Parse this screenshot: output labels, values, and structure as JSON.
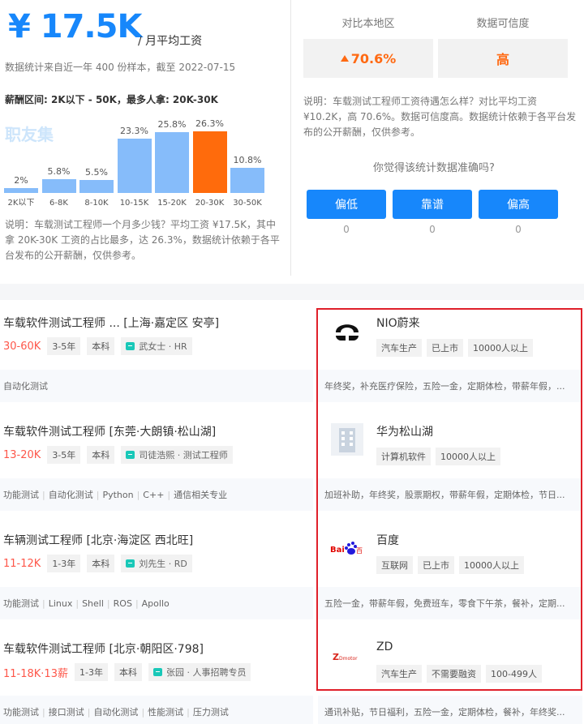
{
  "summary": {
    "salary_value": "¥ 17.5K",
    "salary_unit": "/ 月平均工资",
    "sample_text": "数据统计来自近一年 400 份样本，截至 2022-07-15",
    "range_text": "薪酬区间: 2K以下 - 50K，最多人拿: 20K-30K",
    "watermark": "职友集",
    "description": "说明：车载测试工程师一个月多少钱？平均工资 ¥17.5K，其中拿 20K-30K 工资的占比最多，达 26.3%，数据统计依赖于各平台发布的公开薪酬，仅供参考。"
  },
  "chart_data": {
    "type": "bar",
    "categories": [
      "2K以下",
      "6-8K",
      "8-10K",
      "10-15K",
      "15-20K",
      "20-30K",
      "30-50K"
    ],
    "values": [
      2,
      5.8,
      5.5,
      23.3,
      25.8,
      26.3,
      10.8
    ],
    "value_labels": [
      "2%",
      "5.8%",
      "5.5%",
      "23.3%",
      "25.8%",
      "26.3%",
      "10.8%"
    ],
    "highlight_index": 5,
    "colors": {
      "bar": "#86bcfa",
      "highlight": "#ff6b0c"
    },
    "ylim": [
      0,
      26.3
    ]
  },
  "comparison": {
    "label_local": "对比本地区",
    "label_confidence": "数据可信度",
    "value_local": "70.6%",
    "value_confidence": "高",
    "description": "说明：车载测试工程师工资待遇怎么样？对比平均工资 ¥10.2K，高 70.6%。数据可信度高。数据统计依赖于各平台发布的公开薪酬，仅供参考。",
    "question": "你觉得该统计数据准确吗?",
    "votes": [
      {
        "label": "偏低",
        "count": "0"
      },
      {
        "label": "靠谱",
        "count": "0"
      },
      {
        "label": "偏高",
        "count": "0"
      }
    ]
  },
  "jobs": [
    {
      "title": "车载软件测试工程师 ...   [上海·嘉定区 安亭]",
      "salary": "30-60K",
      "experience": "3-5年",
      "education": "本科",
      "hr": "武女士 · HR",
      "skills": [
        "自动化测试"
      ],
      "company": {
        "name": "NIO蔚来",
        "tags": [
          "汽车生产",
          "已上市",
          "10000人以上"
        ],
        "benefits": "年终奖，补充医疗保险，五险一金，定期体检，带薪年假，...",
        "logo": "nio-logo"
      }
    },
    {
      "title": "车载软件测试工程师  [东莞·大朗镇·松山湖]",
      "salary": "13-20K",
      "experience": "3-5年",
      "education": "本科",
      "hr": "司徒浩熙 · 测试工程师",
      "skills": [
        "功能测试",
        "自动化测试",
        "Python",
        "C++",
        "通信相关专业"
      ],
      "company": {
        "name": "华为松山湖",
        "tags": [
          "计算机软件",
          "10000人以上"
        ],
        "benefits": "加班补助，年终奖，股票期权，带薪年假，定期体检，节日...",
        "logo": "building-logo"
      }
    },
    {
      "title": "车辆测试工程师  [北京·海淀区 西北旺]",
      "salary": "11-12K",
      "experience": "1-3年",
      "education": "本科",
      "hr": "刘先生 · RD",
      "skills": [
        "功能测试",
        "Linux",
        "Shell",
        "ROS",
        "Apollo"
      ],
      "company": {
        "name": "百度",
        "tags": [
          "互联网",
          "已上市",
          "10000人以上"
        ],
        "benefits": "五险一金，带薪年假，免费班车，零食下午茶，餐补，定期...",
        "logo": "baidu-logo"
      }
    },
    {
      "title": "车载软件测试工程师  [北京·朝阳区·798]",
      "salary": "11-18K·13薪",
      "experience": "1-3年",
      "education": "本科",
      "hr": "张园 · 人事招聘专员",
      "skills": [
        "功能测试",
        "接口测试",
        "自动化测试",
        "性能测试",
        "压力测试"
      ],
      "company": {
        "name": "ZD",
        "tags": [
          "汽车生产",
          "不需要融资",
          "100-499人"
        ],
        "benefits": "通讯补贴，节日福利，五险一金，定期体检，餐补，年终奖...",
        "logo": "zd-logo"
      }
    }
  ]
}
